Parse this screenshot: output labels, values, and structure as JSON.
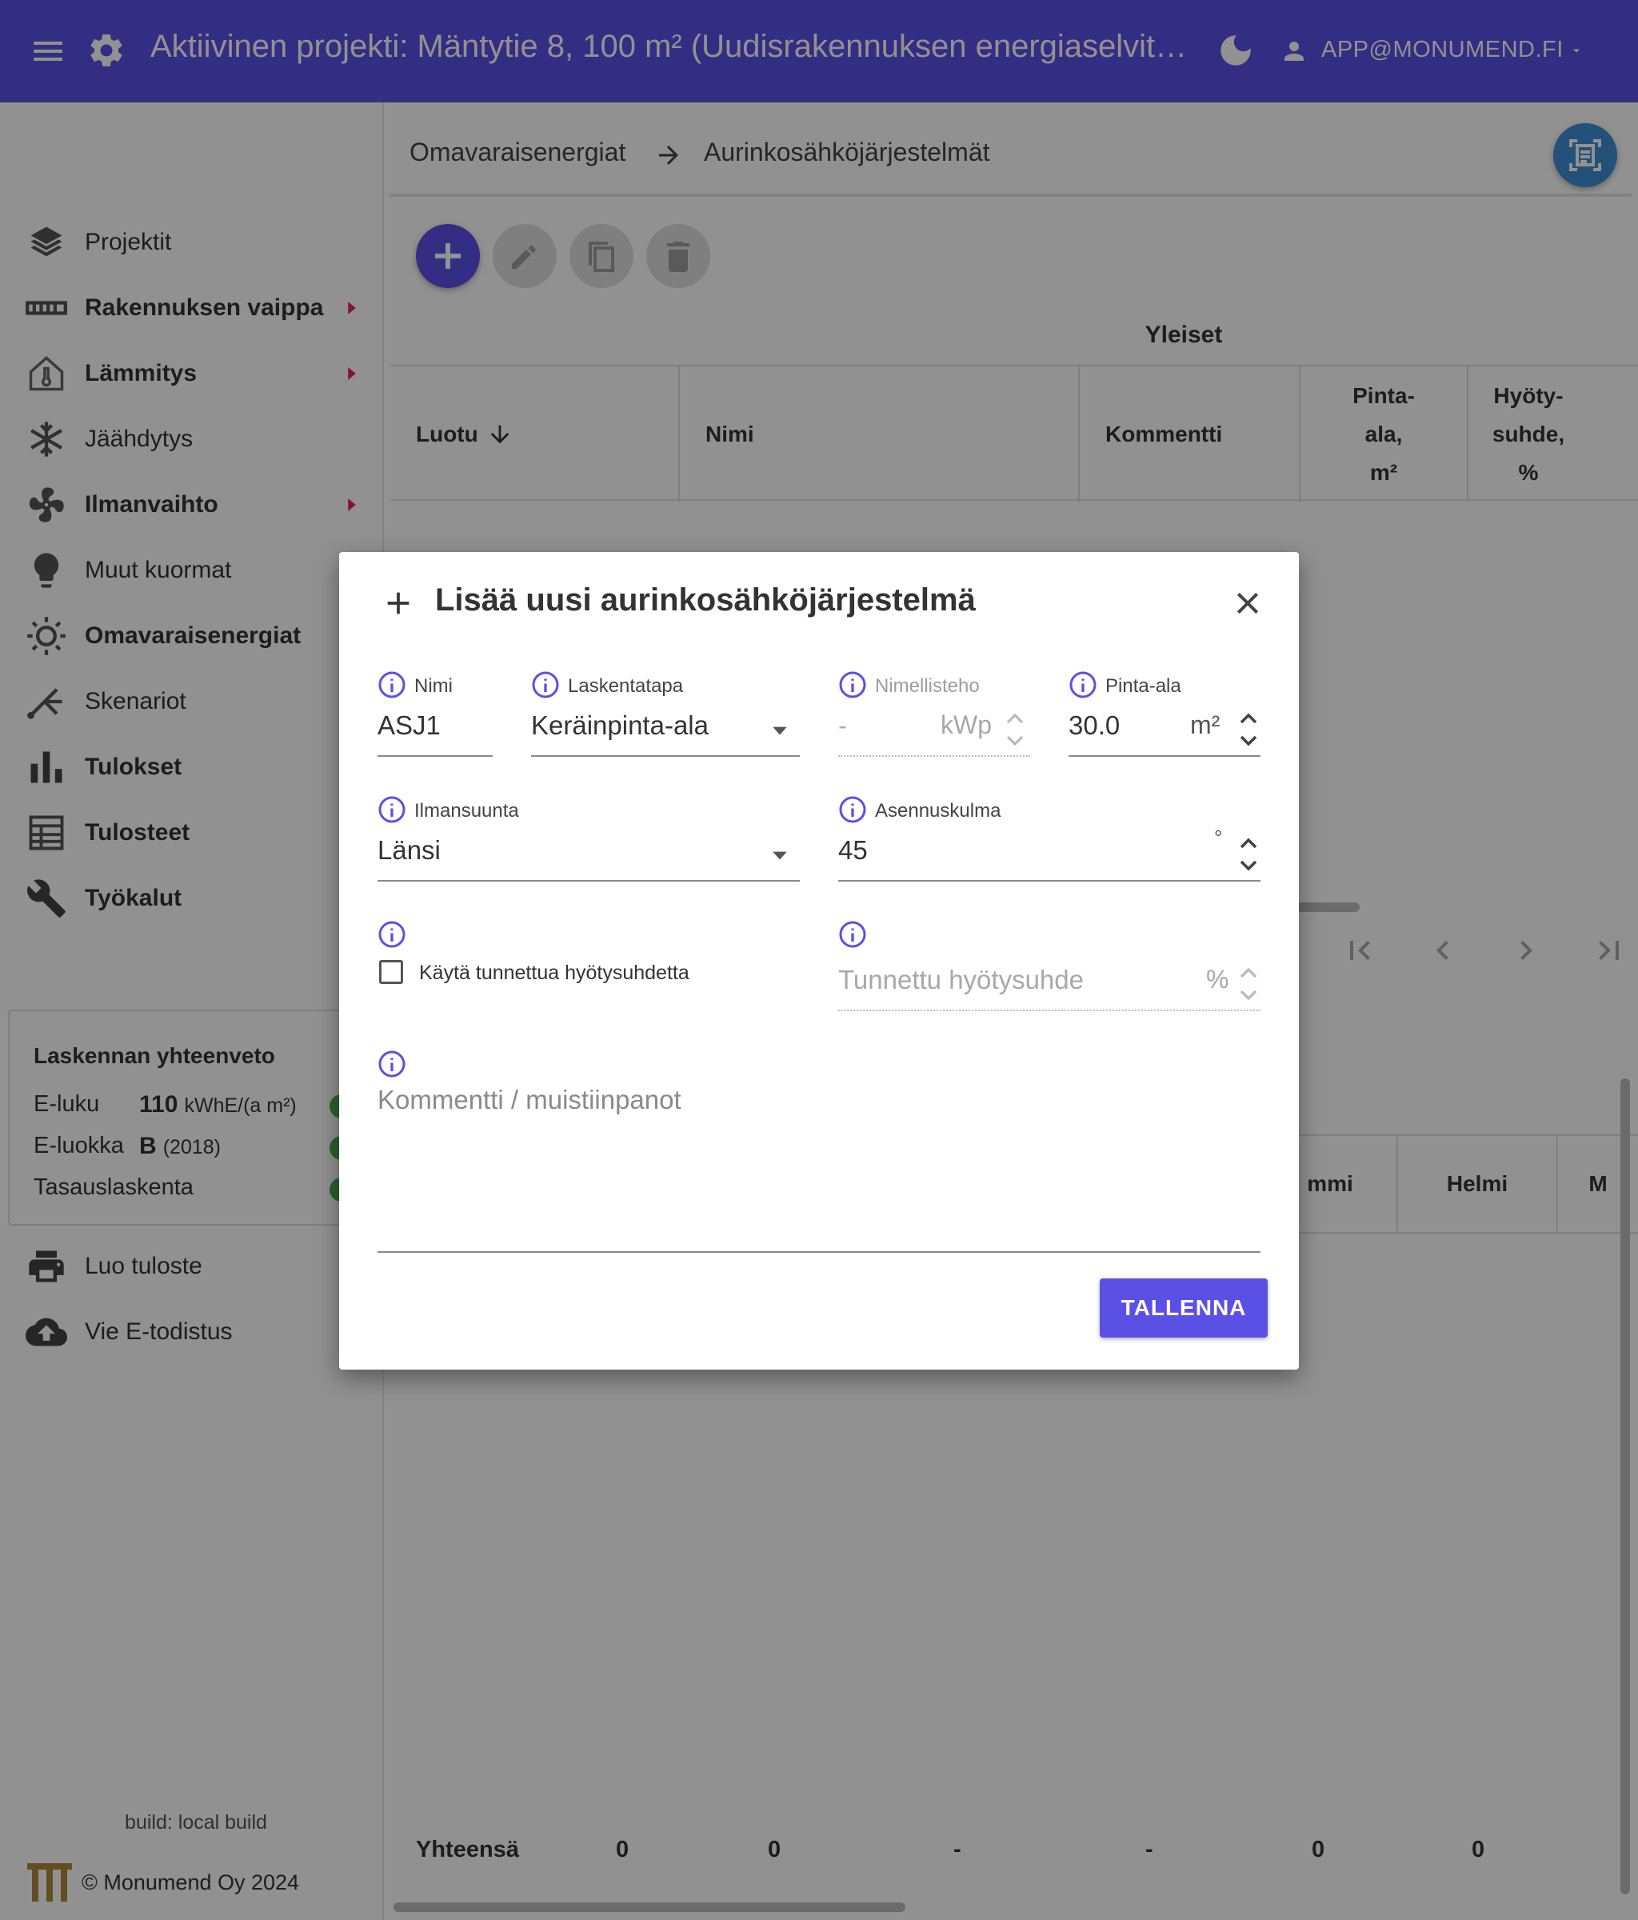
{
  "app_bar": {
    "title": "Aktiivinen projekti: Mäntytie 8, 100 m² (Uudisrakennuksen energiaselvit…",
    "user_email": "APP@MONUMEND.FI"
  },
  "sidebar": {
    "items": [
      {
        "label": "Projektit",
        "icon": "layers-icon",
        "has_submenu": false
      },
      {
        "label": "Rakennuksen vaippa",
        "icon": "wall-icon",
        "has_submenu": true
      },
      {
        "label": "Lämmitys",
        "icon": "house-thermometer-icon",
        "has_submenu": true
      },
      {
        "label": "Jäähdytys",
        "icon": "snowflake-icon",
        "has_submenu": false
      },
      {
        "label": "Ilmanvaihto",
        "icon": "fan-icon",
        "has_submenu": true
      },
      {
        "label": "Muut kuormat",
        "icon": "lightbulb-icon",
        "has_submenu": false
      },
      {
        "label": "Omavaraisenergiat",
        "icon": "sun-icon",
        "has_submenu": false
      },
      {
        "label": "Skenariot",
        "icon": "branch-icon",
        "has_submenu": false
      },
      {
        "label": "Tulokset",
        "icon": "bar-chart-icon",
        "has_submenu": false
      },
      {
        "label": "Tulosteet",
        "icon": "report-icon",
        "has_submenu": false
      },
      {
        "label": "Työkalut",
        "icon": "wrench-icon",
        "has_submenu": false
      }
    ],
    "summary": {
      "title": "Laskennan yhteenveto",
      "e_luku_label": "E-luku",
      "e_luku_value": "110",
      "e_luku_unit": "kWhE/(a m²)",
      "e_luokka_label": "E-luokka",
      "e_luokka_value": "B",
      "e_luokka_year": "(2018)",
      "tasaus_label": "Tasauslaskenta",
      "status_color": "#4caf50"
    },
    "actions": [
      {
        "label": "Luo tuloste",
        "icon": "printer-icon"
      },
      {
        "label": "Vie E-todistus",
        "icon": "cloud-upload-icon"
      }
    ],
    "build": "build: local build",
    "copyright": "© Monumend Oy 2024"
  },
  "breadcrumb": {
    "first": "Omavaraisenergiat",
    "second": "Aurinkosähköjärjestelmät"
  },
  "table": {
    "group_header": "Yleiset",
    "columns": [
      {
        "label": "Luotu",
        "sorted": "desc"
      },
      {
        "label": "Nimi"
      },
      {
        "label": "Kommentti"
      },
      {
        "label": "Pinta-\nala,\nm²"
      },
      {
        "label": "Hyöty-\nsuhde,\n%"
      }
    ],
    "monthly_columns": [
      "mmi",
      "Helmi",
      "M"
    ],
    "totals_label": "Yhteensä",
    "totals": [
      "0",
      "0",
      "-",
      "-",
      "0",
      "0"
    ]
  },
  "dialog": {
    "title": "Lisää uusi aurinkosähköjärjestelmä",
    "fields": {
      "nimi": {
        "label": "Nimi",
        "value": "ASJ1"
      },
      "laskentatapa": {
        "label": "Laskentatapa",
        "value": "Keräinpinta-ala"
      },
      "nimellisteho": {
        "label": "Nimellisteho",
        "value": "-",
        "unit": "kWp",
        "disabled": true
      },
      "pinta_ala": {
        "label": "Pinta-ala",
        "value": "30.0",
        "unit": "m²"
      },
      "ilmansuunta": {
        "label": "Ilmansuunta",
        "value": "Länsi"
      },
      "asennuskulma": {
        "label": "Asennuskulma",
        "value": "45",
        "unit": "°"
      },
      "kayta_tunnettua": {
        "label": "Käytä tunnettua hyötysuhdetta",
        "checked": false
      },
      "tunnettu_hyotysuhde": {
        "placeholder": "Tunnettu hyötysuhde",
        "unit": "%",
        "disabled": true
      },
      "kommentti": {
        "placeholder": "Kommentti / muistiinpanot"
      }
    },
    "save_label": "TALLENNA"
  },
  "colors": {
    "primary": "#5b50e6",
    "scan_button": "#3f8fd6",
    "submenu_arrow": "#e91e63",
    "info_icon": "#5b50e6"
  }
}
